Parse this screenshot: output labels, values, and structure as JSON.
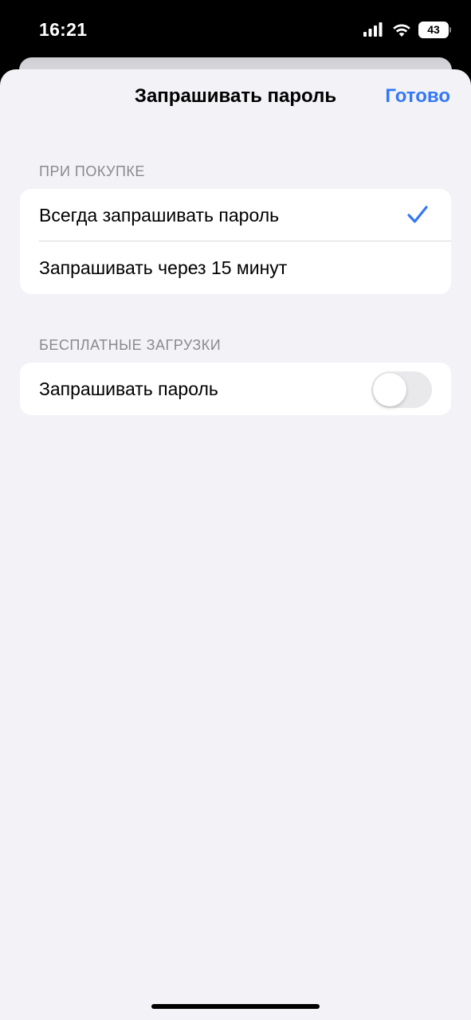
{
  "status_bar": {
    "time": "16:21",
    "battery": "43",
    "signal_icon": "cellular-signal-icon",
    "wifi_icon": "wifi-icon"
  },
  "header": {
    "title": "Запрашивать пароль",
    "done_label": "Готово"
  },
  "sections": [
    {
      "header": "ПРИ ПОКУПКЕ",
      "rows": [
        {
          "label": "Всегда запрашивать пароль",
          "selected": true
        },
        {
          "label": "Запрашивать через 15 минут",
          "selected": false
        }
      ]
    },
    {
      "header": "БЕСПЛАТНЫЕ ЗАГРУЗКИ",
      "rows": [
        {
          "label": "Запрашивать пароль",
          "toggle": false
        }
      ]
    }
  ],
  "colors": {
    "accent": "#3478f6",
    "background": "#f2f2f7",
    "section_header": "#8a8a8e",
    "toggle_off": "#e9e9eb"
  }
}
